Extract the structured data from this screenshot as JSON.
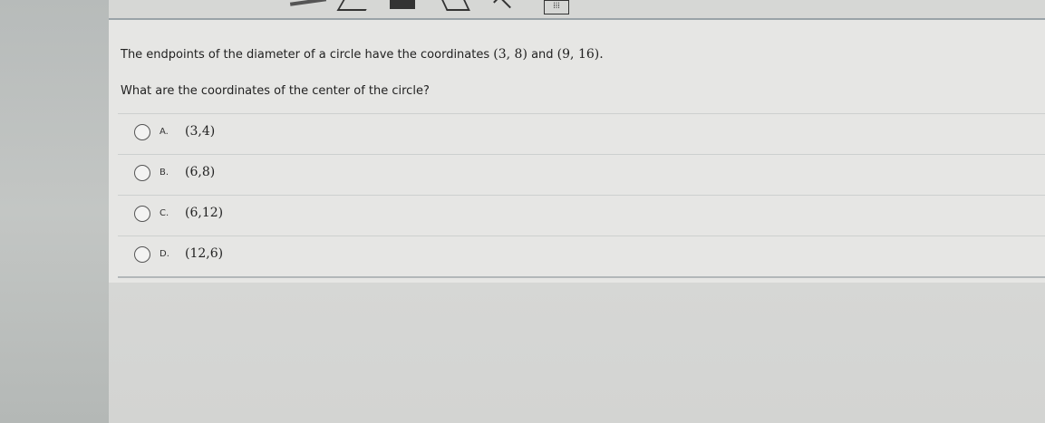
{
  "toolbar": {
    "icons": [
      "line-tool-icon",
      "angle-tool-icon",
      "segment-tool-icon",
      "shape-tool-icon",
      "chevron-tool-icon",
      "keypad-icon"
    ]
  },
  "question": {
    "line1_text": "The endpoints of the diameter of a circle have the coordinates",
    "point_a": "(3, 8)",
    "and_word": "and",
    "point_b": "(9, 16).",
    "line2": "What are the coordinates of the center of the circle?"
  },
  "choices": [
    {
      "letter": "A.",
      "value": "(3,4)"
    },
    {
      "letter": "B.",
      "value": "(6,8)"
    },
    {
      "letter": "C.",
      "value": "(6,12)"
    },
    {
      "letter": "D.",
      "value": "(12,6)"
    }
  ],
  "colors": {
    "background": "#d9d9d7",
    "panel": "#e6e6e4",
    "divider": "#cdd0cf",
    "text": "#222222"
  }
}
